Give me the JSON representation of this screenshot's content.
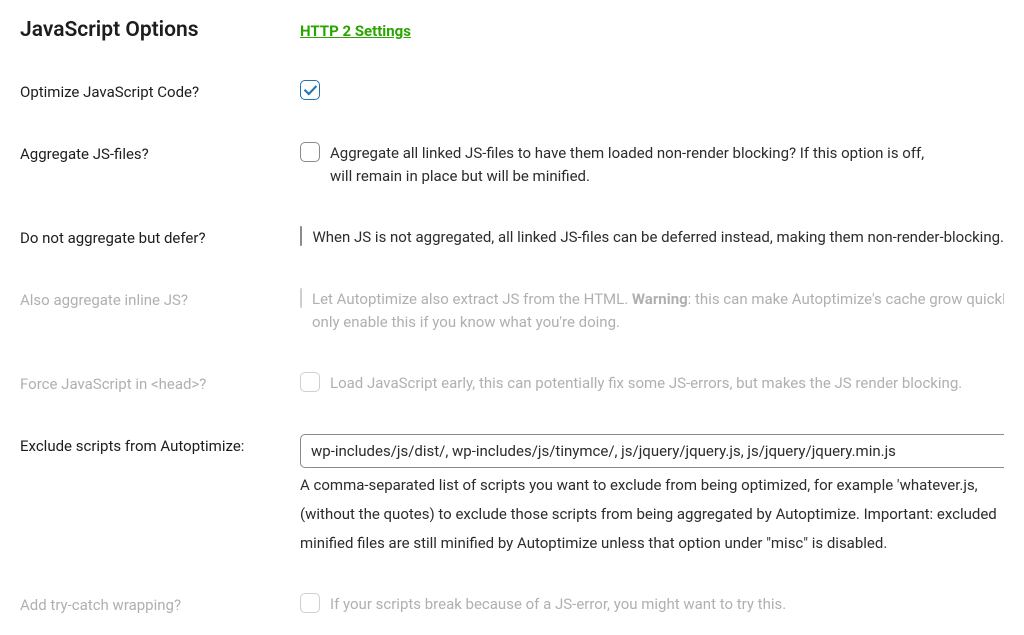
{
  "header": {
    "title": "JavaScript Options",
    "link_text": "HTTP 2 Settings"
  },
  "rows": {
    "optimize": {
      "label": "Optimize JavaScript Code?"
    },
    "aggregate": {
      "label": "Aggregate JS-files?",
      "line1": "Aggregate all linked JS-files to have them loaded non-render blocking? If this option is off,",
      "line2": "will remain in place but will be minified."
    },
    "defer": {
      "label": "Do not aggregate but defer?",
      "desc": "When JS is not aggregated, all linked JS-files can be deferred instead, making them non-render-blocking."
    },
    "inline": {
      "label": "Also aggregate inline JS?",
      "line1_pre": "Let Autoptimize also extract JS from the HTML. ",
      "line1_bold": "Warning",
      "line1_post": ": this can make Autoptimize's cache grow quickly,",
      "line2": "only enable this if you know what you're doing."
    },
    "head": {
      "label": "Force JavaScript in <head>?",
      "desc": "Load JavaScript early, this can potentially fix some JS-errors, but makes the JS render blocking."
    },
    "exclude": {
      "label": "Exclude scripts from Autoptimize:",
      "value": "wp-includes/js/dist/, wp-includes/js/tinymce/, js/jquery/jquery.js, js/jquery/jquery.min.js",
      "help1": "A comma-separated list of scripts you want to exclude from being optimized, for example 'whatever.js,",
      "help2": "(without the quotes) to exclude those scripts from being aggregated by Autoptimize. Important: excluded",
      "help3": "minified files are still minified by Autoptimize unless that option under \"misc\" is disabled."
    },
    "trycatch": {
      "label": "Add try-catch wrapping?",
      "desc": "If your scripts break because of a JS-error, you might want to try this."
    }
  }
}
